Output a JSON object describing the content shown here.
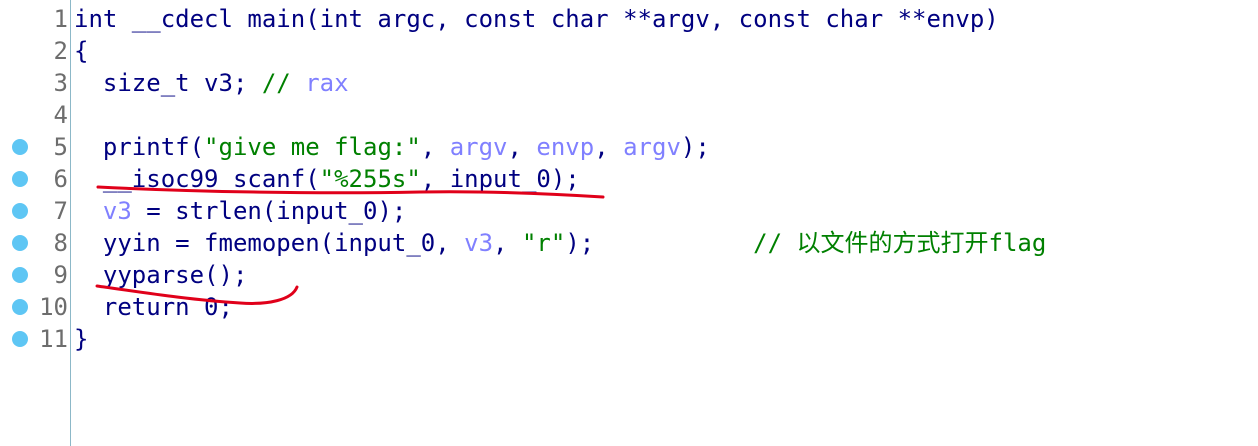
{
  "editor": {
    "lines": [
      {
        "num": "1",
        "breakpoint": false,
        "tokens": [
          {
            "t": "int __cdecl main(int argc, const char **argv, const char **envp)",
            "c": "pl"
          }
        ]
      },
      {
        "num": "2",
        "breakpoint": false,
        "tokens": [
          {
            "t": "{",
            "c": "pl"
          }
        ]
      },
      {
        "num": "3",
        "breakpoint": false,
        "tokens": [
          {
            "t": "  size_t v3; ",
            "c": "pl"
          },
          {
            "t": "// ",
            "c": "cm"
          },
          {
            "t": "rax",
            "c": "cm-var"
          }
        ]
      },
      {
        "num": "4",
        "breakpoint": false,
        "tokens": []
      },
      {
        "num": "5",
        "breakpoint": true,
        "tokens": [
          {
            "t": "  printf(",
            "c": "pl"
          },
          {
            "t": "\"give me flag:\"",
            "c": "str"
          },
          {
            "t": ", ",
            "c": "pl"
          },
          {
            "t": "argv",
            "c": "var"
          },
          {
            "t": ", ",
            "c": "pl"
          },
          {
            "t": "envp",
            "c": "var"
          },
          {
            "t": ", ",
            "c": "pl"
          },
          {
            "t": "argv",
            "c": "var"
          },
          {
            "t": ");",
            "c": "pl"
          }
        ]
      },
      {
        "num": "6",
        "breakpoint": true,
        "tokens": [
          {
            "t": "  __isoc99_scanf(",
            "c": "pl"
          },
          {
            "t": "\"%255s\"",
            "c": "str"
          },
          {
            "t": ", input_0);",
            "c": "pl"
          }
        ]
      },
      {
        "num": "7",
        "breakpoint": true,
        "tokens": [
          {
            "t": "  ",
            "c": "pl"
          },
          {
            "t": "v3",
            "c": "var"
          },
          {
            "t": " = strlen(input_0);",
            "c": "pl"
          }
        ]
      },
      {
        "num": "8",
        "breakpoint": true,
        "tokens": [
          {
            "t": "  yyin = fmemopen(input_0, ",
            "c": "pl"
          },
          {
            "t": "v3",
            "c": "var"
          },
          {
            "t": ", ",
            "c": "pl"
          },
          {
            "t": "\"r\"",
            "c": "str"
          },
          {
            "t": ");           ",
            "c": "pl"
          },
          {
            "t": "// 以文件的方式打开flag",
            "c": "cm"
          }
        ]
      },
      {
        "num": "9",
        "breakpoint": true,
        "tokens": [
          {
            "t": "  yyparse();",
            "c": "pl"
          }
        ]
      },
      {
        "num": "10",
        "breakpoint": true,
        "tokens": [
          {
            "t": "  return 0;",
            "c": "pl"
          }
        ]
      },
      {
        "num": "11",
        "breakpoint": true,
        "tokens": [
          {
            "t": "}",
            "c": "pl"
          }
        ]
      }
    ]
  },
  "colors": {
    "plain": "#000080",
    "variable": "#8080ff",
    "string": "#008000",
    "comment": "#008000",
    "breakpoint": "#5ec6f4",
    "annotation": "#e0001a"
  }
}
